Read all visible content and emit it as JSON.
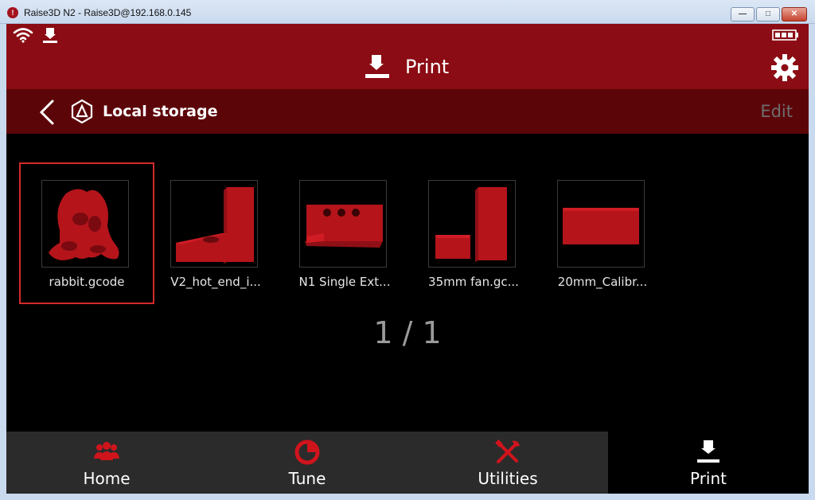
{
  "window": {
    "title": "Raise3D N2 - Raise3D@192.168.0.145",
    "app_icon_glyph": "!",
    "minimize_glyph": "—",
    "maximize_glyph": "□",
    "close_glyph": "✕"
  },
  "status_bar": {
    "icons": [
      "wifi-icon",
      "download-icon",
      "battery-icon"
    ]
  },
  "header": {
    "title": "Print",
    "icons": [
      "printer-icon",
      "gear-icon"
    ]
  },
  "subheader": {
    "title": "Local storage",
    "edit_label": "Edit",
    "icons": [
      "back-icon",
      "storage-icon"
    ]
  },
  "files": [
    {
      "name": "rabbit.gcode",
      "selected": true
    },
    {
      "name": "V2_hot_end_i...",
      "selected": false
    },
    {
      "name": "N1 Single Ext...",
      "selected": false
    },
    {
      "name": "35mm fan.gc...",
      "selected": false
    },
    {
      "name": "20mm_Calibr...",
      "selected": false
    }
  ],
  "pager": {
    "text": "1 / 1"
  },
  "nav": {
    "tabs": [
      {
        "label": "Home",
        "icon": "users-icon",
        "active": false
      },
      {
        "label": "Tune",
        "icon": "tune-icon",
        "active": false
      },
      {
        "label": "Utilities",
        "icon": "tools-icon",
        "active": false
      },
      {
        "label": "Print",
        "icon": "printer-icon",
        "active": true
      }
    ]
  },
  "colors": {
    "brand_red": "#8b0c14",
    "subheader_red": "#5c0509",
    "model_red": "#b5141b",
    "selection_red": "#d42a2a",
    "background": "#000000",
    "nav_background": "#2b2b2b"
  }
}
